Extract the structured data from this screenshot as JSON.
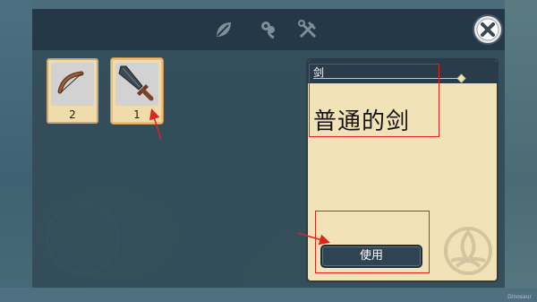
{
  "topbar": {
    "tabs": [
      {
        "icon": "leaf-icon"
      },
      {
        "icon": "flower-icon"
      },
      {
        "icon": "crossed-tools-icon"
      }
    ],
    "close_icon": "close-icon"
  },
  "inventory": {
    "slots": [
      {
        "item_icon": "bow-icon",
        "count": "2"
      },
      {
        "item_icon": "sword-icon",
        "count": "1"
      }
    ]
  },
  "detail": {
    "header_label": "剑",
    "item_name": "普通的剑",
    "use_button": "使用",
    "emblem_icon": "knot-emblem-icon"
  },
  "colors": {
    "panel_bg": "#f2e2b7",
    "header_bg": "#2a3c4a",
    "annotation_red": "#e0241c",
    "slot_bg": "#f0dcab"
  },
  "watermark": "Dinosaur"
}
